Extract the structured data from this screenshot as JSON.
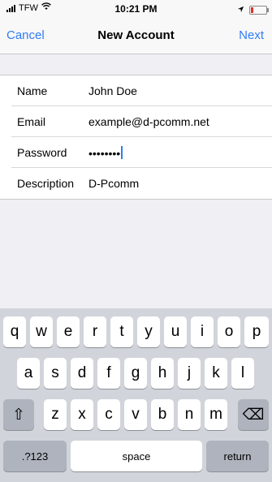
{
  "status_bar": {
    "carrier": "TFW",
    "time": "10:21 PM"
  },
  "nav": {
    "cancel": "Cancel",
    "title": "New Account",
    "next": "Next"
  },
  "form": {
    "rows": [
      {
        "label": "Name",
        "value": "John Doe"
      },
      {
        "label": "Email",
        "value": "example@d-pcomm.net"
      },
      {
        "label": "Password",
        "value": "••••••••"
      },
      {
        "label": "Description",
        "value": "D-Pcomm"
      }
    ]
  },
  "keyboard": {
    "row1": [
      "q",
      "w",
      "e",
      "r",
      "t",
      "y",
      "u",
      "i",
      "o",
      "p"
    ],
    "row2": [
      "a",
      "s",
      "d",
      "f",
      "g",
      "h",
      "j",
      "k",
      "l"
    ],
    "row3": [
      "z",
      "x",
      "c",
      "v",
      "b",
      "n",
      "m"
    ],
    "shift": "⇧",
    "delete": "⌫",
    "numbers": ".?123",
    "space": "space",
    "return": "return"
  },
  "colors": {
    "accent": "#2e7cf6",
    "background": "#efeff4",
    "keyboard": "#d1d4da",
    "battery_low": "#e0302c"
  }
}
